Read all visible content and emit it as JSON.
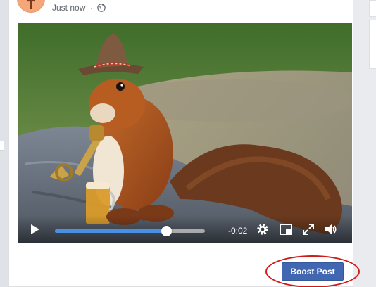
{
  "post": {
    "author_initial": "T",
    "timestamp": "Just now",
    "separator": "·",
    "privacy_icon": "globe-icon"
  },
  "video": {
    "progress": 0.74,
    "time_remaining": "-0:02",
    "icons": [
      "play-icon",
      "settings-icon",
      "pip-icon",
      "fullscreen-icon",
      "volume-icon"
    ]
  },
  "footer": {
    "boost_label": "Boost Post"
  },
  "colors": {
    "boost_button": "#4267b2",
    "progress_fill": "#4a90e2",
    "highlight_ring": "#d11a1a"
  }
}
